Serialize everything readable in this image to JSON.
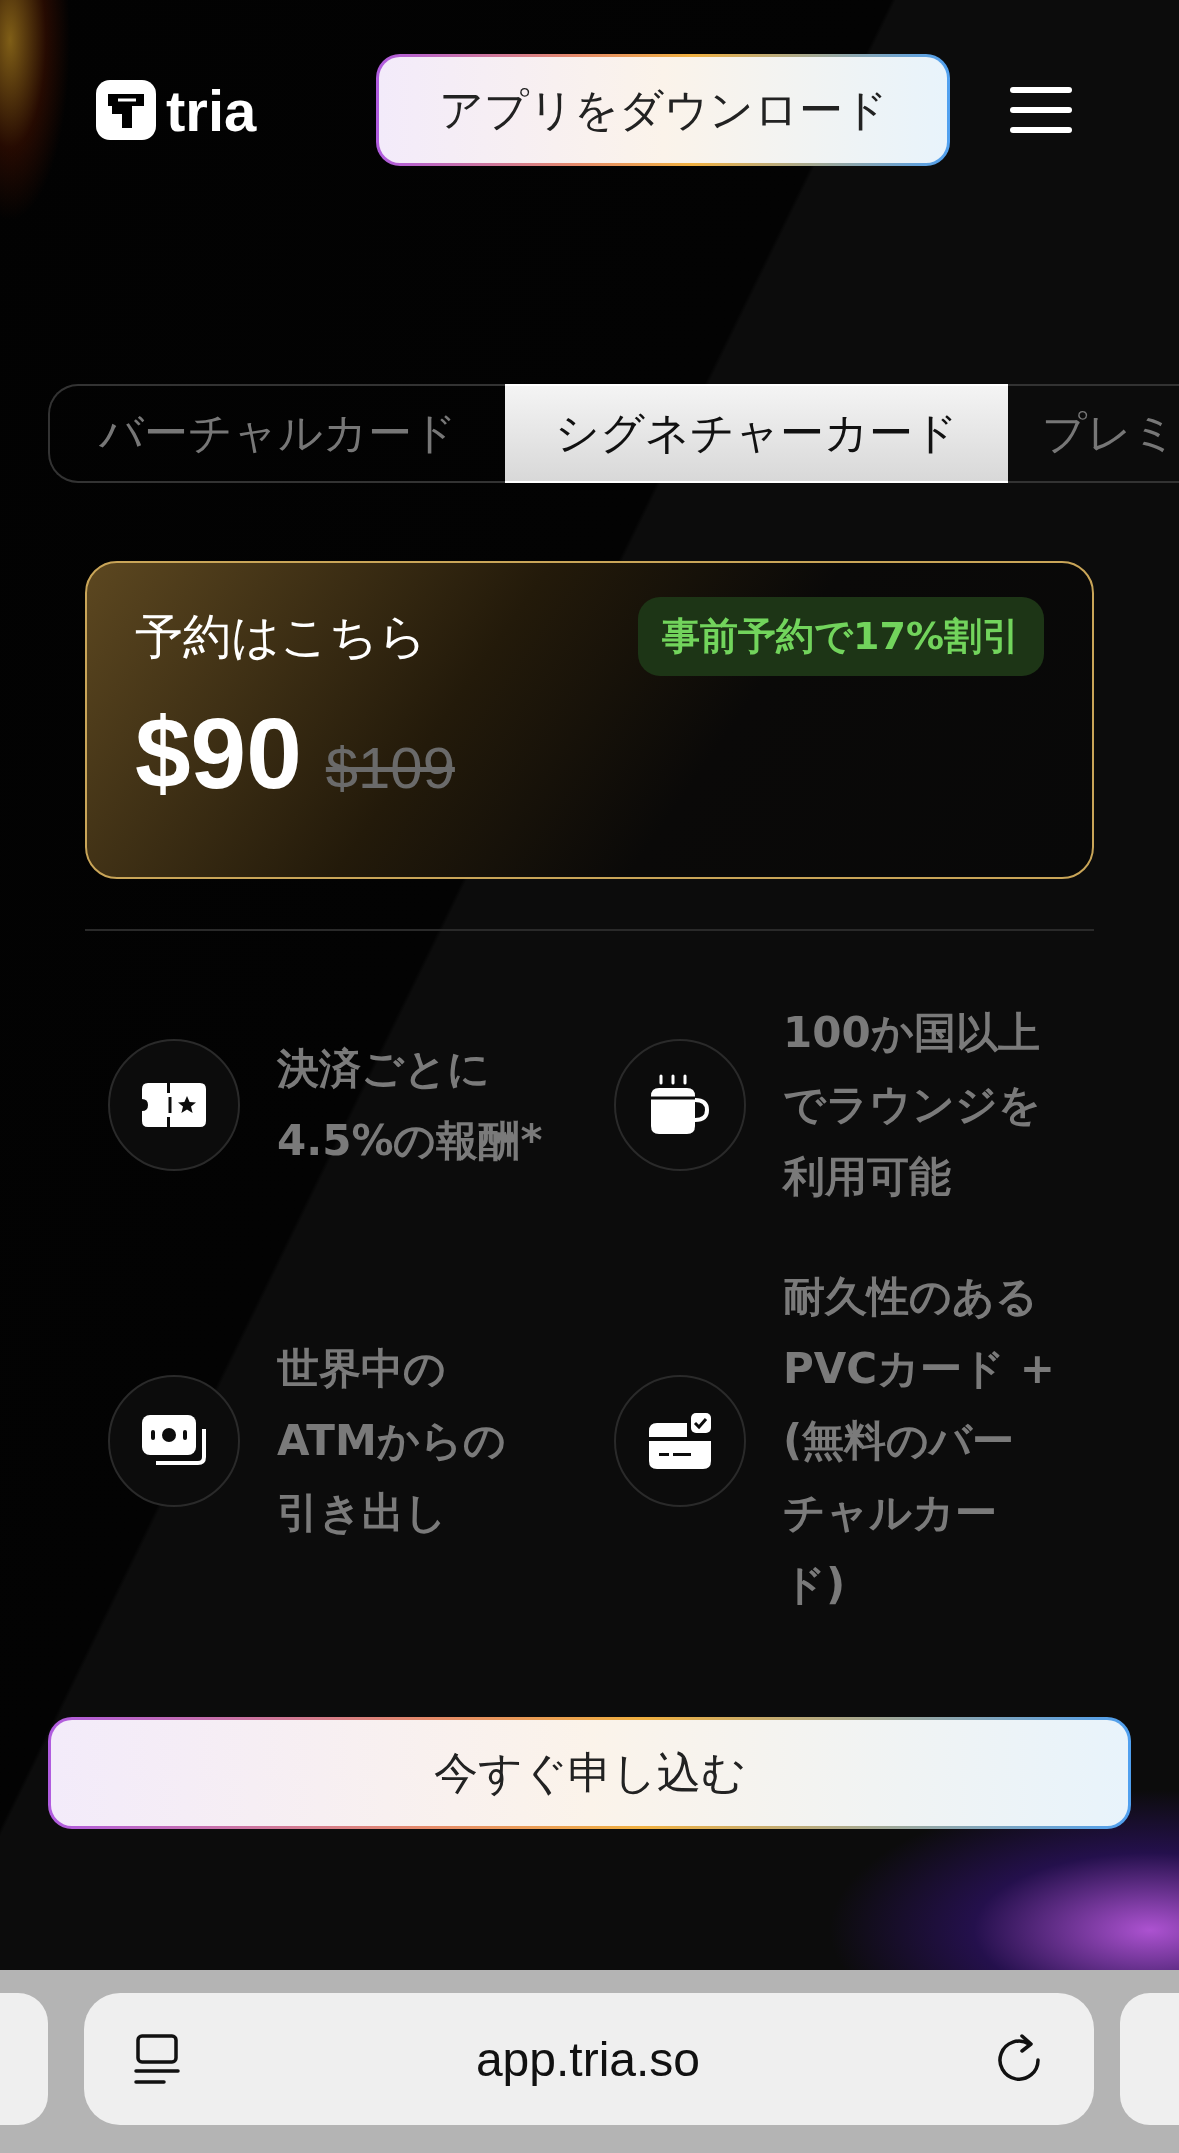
{
  "header": {
    "logo": "tria",
    "download_button": "アプリをダウンロード"
  },
  "tabs": [
    {
      "label": "バーチャルカード",
      "selected": false
    },
    {
      "label": "シグネチャーカード",
      "selected": true
    },
    {
      "label": "プレミ",
      "selected": false
    }
  ],
  "card": {
    "title": "予約はこちら",
    "badge": "事前予約で17%割引",
    "price": "$90",
    "old_price": "$109"
  },
  "features": [
    {
      "kind": "ticket",
      "lines": [
        "決済ごとに",
        "4.5%の報酬*"
      ]
    },
    {
      "kind": "cup",
      "lines": [
        "100か国以上",
        "でラウンジを",
        "利用可能"
      ]
    },
    {
      "kind": "cash",
      "lines": [
        "世界中の",
        "ATMからの",
        "引き出し"
      ]
    },
    {
      "kind": "card",
      "lines": [
        "耐久性のある",
        "PVCカード +",
        "(無料のバー",
        "チャルカー",
        "ド)"
      ]
    }
  ],
  "apply_button": "今すぐ申し込む",
  "browser": {
    "url": "app.tria.so"
  }
}
